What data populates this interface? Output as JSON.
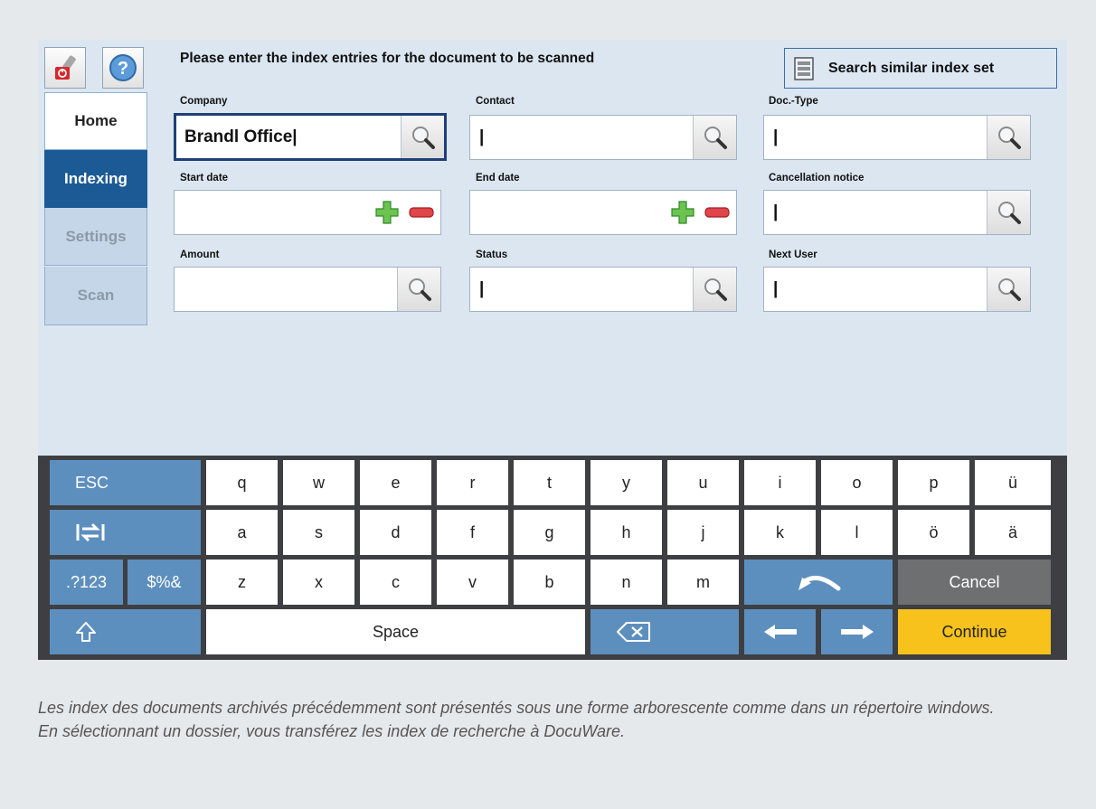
{
  "sidebar": {
    "items": [
      {
        "label": "Home"
      },
      {
        "label": "Indexing"
      },
      {
        "label": "Settings"
      },
      {
        "label": "Scan"
      }
    ]
  },
  "header": {
    "title": "Please enter the index entries for the document to be scanned",
    "search_similar_label": "Search similar index set"
  },
  "fields": {
    "company": {
      "label": "Company",
      "value": "Brandl Office|"
    },
    "contact": {
      "label": "Contact",
      "value": "|"
    },
    "doctype": {
      "label": "Doc.-Type",
      "value": "|"
    },
    "start_date": {
      "label": "Start date",
      "value": ""
    },
    "end_date": {
      "label": "End date",
      "value": ""
    },
    "cancellation": {
      "label": "Cancellation notice",
      "value": "|"
    },
    "amount": {
      "label": "Amount",
      "value": ""
    },
    "status": {
      "label": "Status",
      "value": "|"
    },
    "next_user": {
      "label": "Next User",
      "value": "|"
    }
  },
  "keyboard": {
    "esc": "ESC",
    "row1": [
      "q",
      "w",
      "e",
      "r",
      "t",
      "y",
      "u",
      "i",
      "o",
      "p",
      "ü"
    ],
    "row2": [
      "a",
      "s",
      "d",
      "f",
      "g",
      "h",
      "j",
      "k",
      "l",
      "ö",
      "ä"
    ],
    "num": ".?123",
    "sym": "$%&",
    "row3": [
      "z",
      "x",
      "c",
      "v",
      "b",
      "n",
      "m"
    ],
    "cancel": "Cancel",
    "space": "Space",
    "continue": "Continue"
  },
  "colors": {
    "nav_active": "#1c5a96",
    "key_blue": "#5d8fbe",
    "continue": "#f7c21b"
  },
  "caption": "Les index des documents archivés précédemment sont présentés sous une forme arborescente comme dans un répertoire windows. En sélectionnant un dossier, vous transférez les index de recherche à DocuWare."
}
